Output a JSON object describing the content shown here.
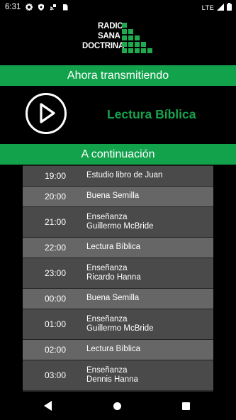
{
  "status_bar": {
    "time": "6:31",
    "network": "LTE",
    "icons": [
      "settings-icon",
      "shield-icon",
      "cast-icon",
      "sim-card-icon",
      "wifi-icon",
      "signal-icon",
      "battery-icon"
    ]
  },
  "logo": {
    "line1": "RADIO",
    "line2": "SANA",
    "line3": "DOCTRINA",
    "color": "#1faa4f"
  },
  "now_playing": {
    "header": "Ahora transmitiendo",
    "title": "Lectura Bíblica"
  },
  "schedule": {
    "header": "A continuación",
    "items": [
      {
        "time": "19:00",
        "program": "Estudio libro de Juan",
        "speaker": ""
      },
      {
        "time": "20:00",
        "program": "Buena Semilla",
        "speaker": ""
      },
      {
        "time": "21:00",
        "program": "Enseñanza",
        "speaker": "Guillermo McBride"
      },
      {
        "time": "22:00",
        "program": "Lectura Bíblica",
        "speaker": ""
      },
      {
        "time": "23:00",
        "program": "Enseñanza",
        "speaker": "Ricardo Hanna"
      },
      {
        "time": "00:00",
        "program": "Buena Semilla",
        "speaker": ""
      },
      {
        "time": "01:00",
        "program": "Enseñanza",
        "speaker": "Guillermo McBride"
      },
      {
        "time": "02:00",
        "program": "Lectura Bíblica",
        "speaker": ""
      },
      {
        "time": "03:00",
        "program": "Enseñanza",
        "speaker": "Dennis Hanna"
      }
    ]
  },
  "colors": {
    "accent": "#13a24c",
    "background": "#000000",
    "row_dark": "#4a4a4a",
    "row_light": "#666666"
  }
}
